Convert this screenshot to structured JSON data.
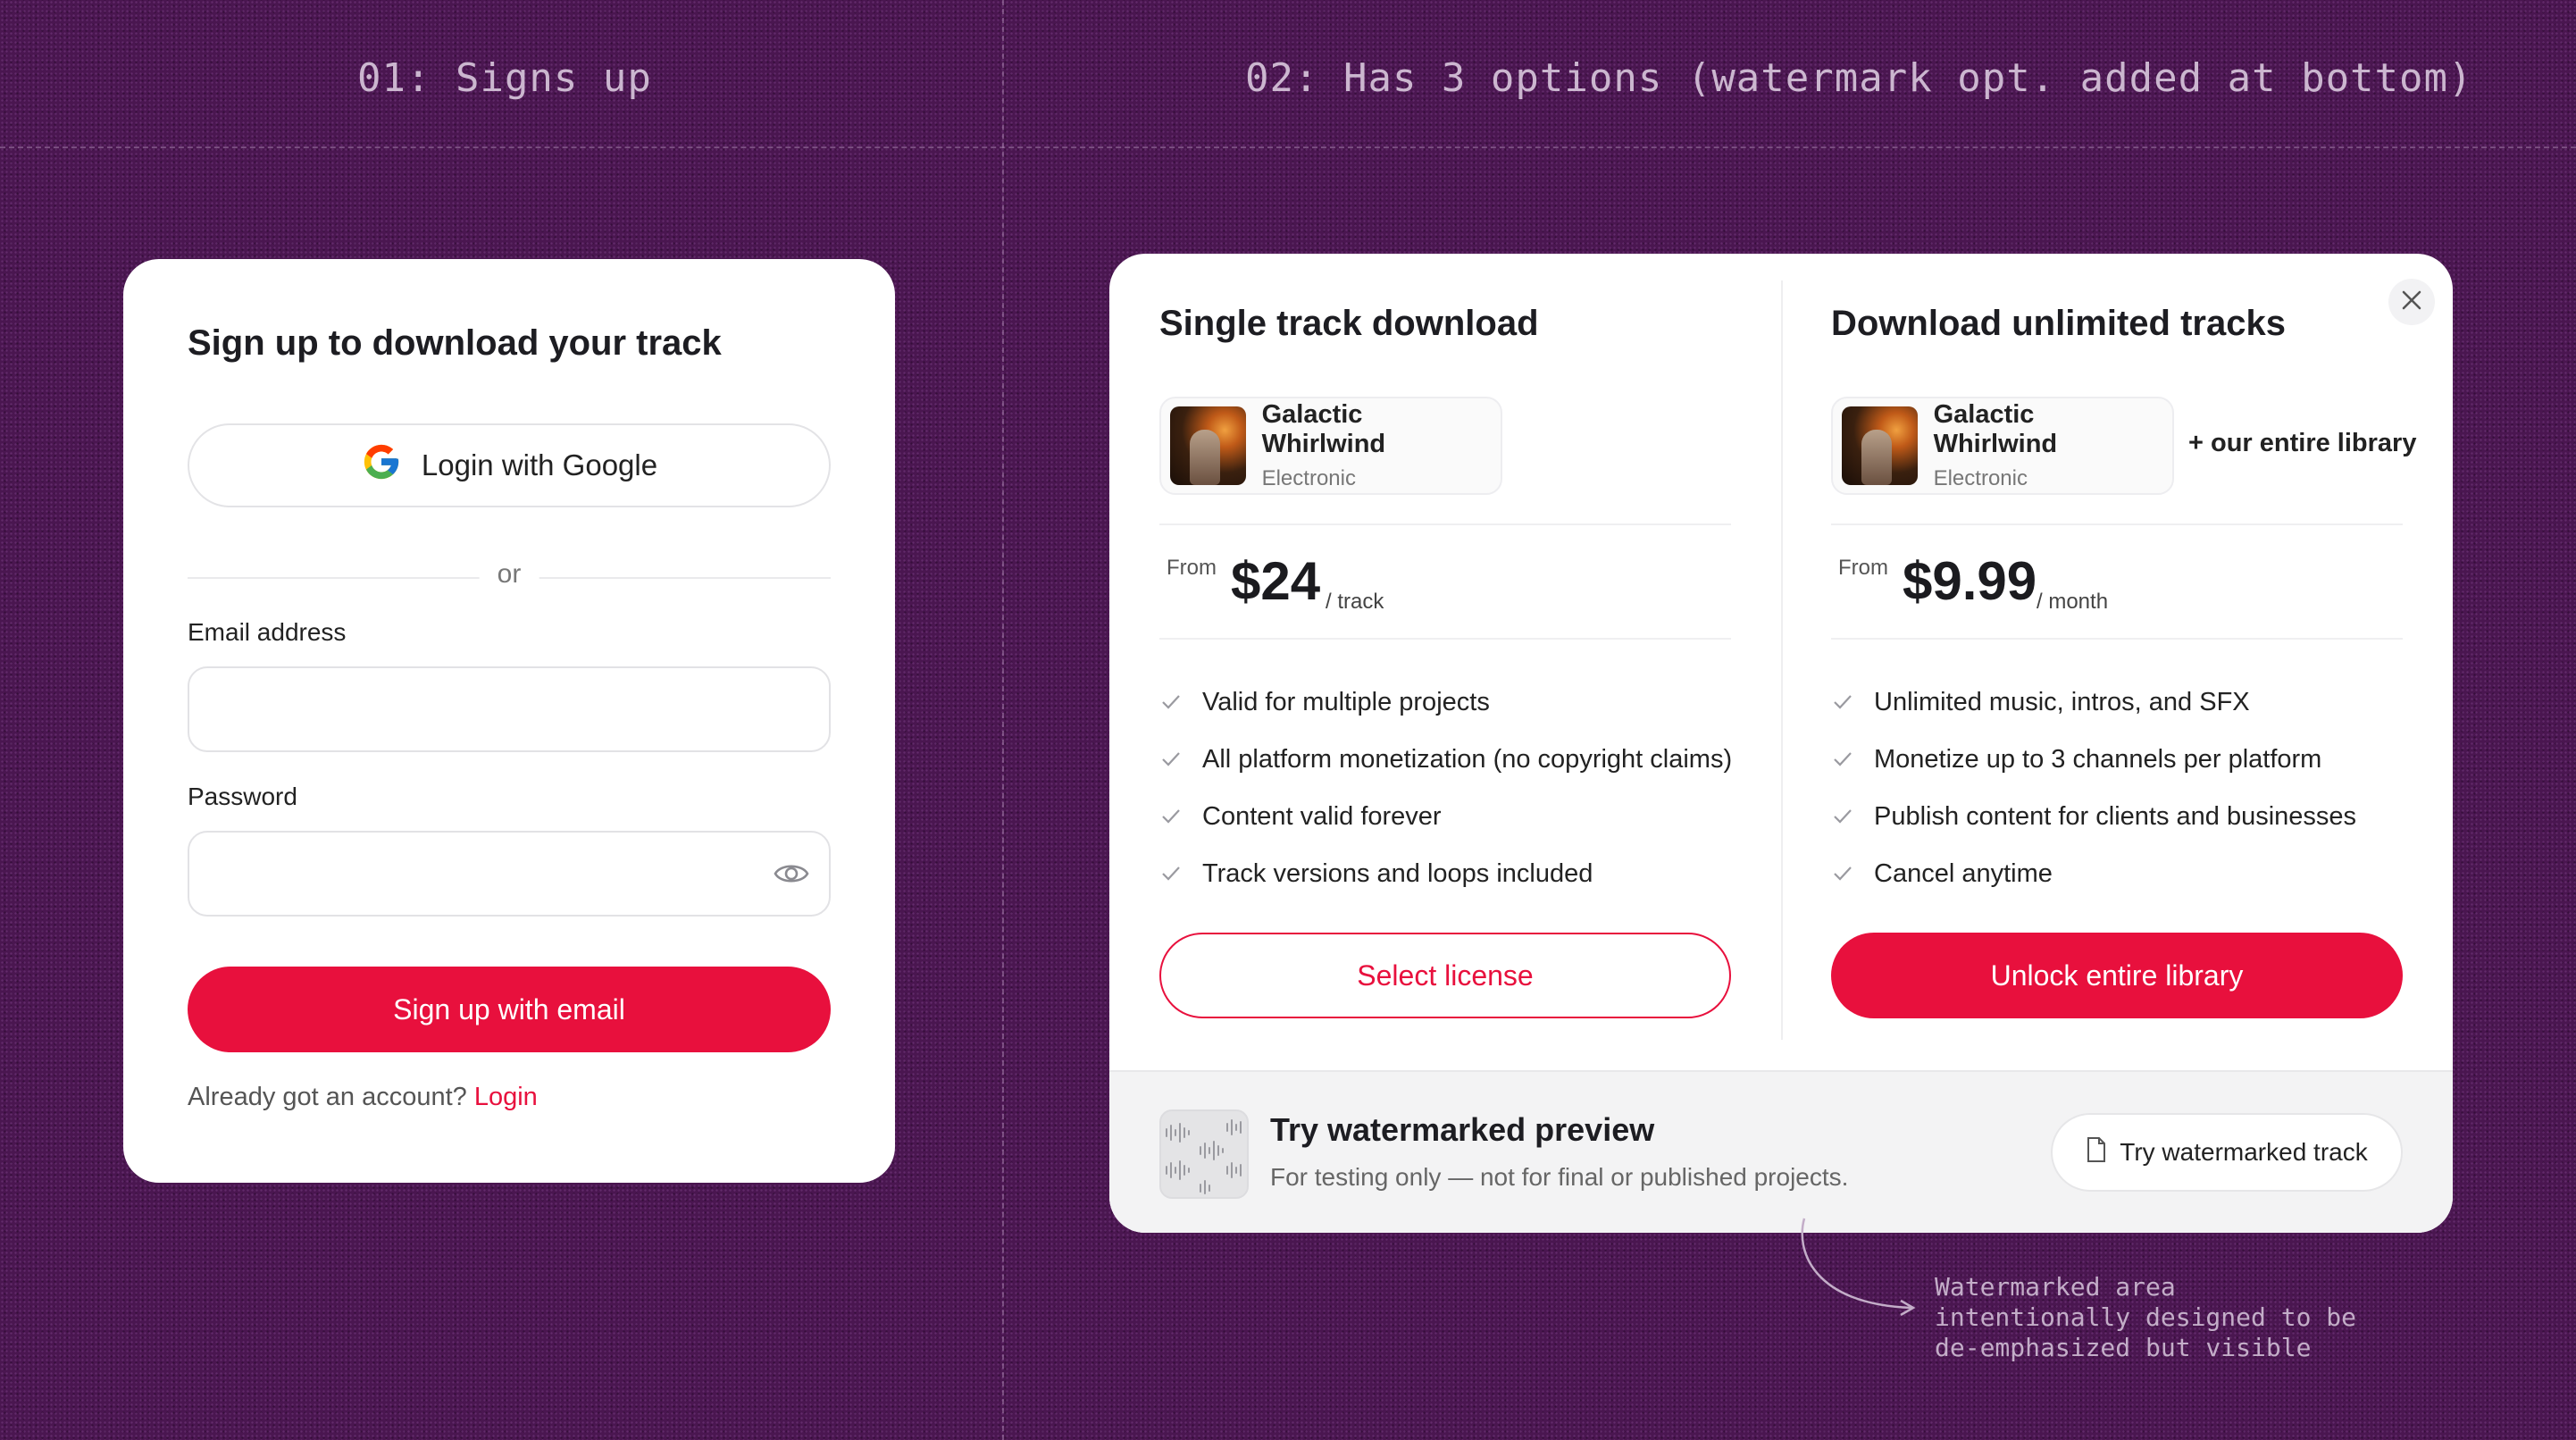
{
  "steps": {
    "step1_title": "01: Signs up",
    "step2_title": "02: Has 3 options (watermark opt. added at bottom)"
  },
  "signup": {
    "title": "Sign up to download your track",
    "google_label": "Login with Google",
    "divider_text": "or",
    "email_label": "Email address",
    "email_value": "",
    "password_label": "Password",
    "password_value": "",
    "submit_label": "Sign up with email",
    "already_text": "Already got an account?",
    "login_link": "Login"
  },
  "pricing": {
    "single": {
      "title": "Single track download",
      "track_name": "Galactic Whirlwind",
      "track_genre": "Electronic",
      "from_label": "From",
      "price": "$24",
      "period": "/ track",
      "features": [
        "Valid for multiple projects",
        "All platform monetization (no copyright claims)",
        "Content valid forever",
        "Track versions and loops included"
      ],
      "button_label": "Select license"
    },
    "unlimited": {
      "title": "Download unlimited tracks",
      "track_name": "Galactic Whirlwind",
      "track_genre": "Electronic",
      "extra_label": "+ our entire library",
      "from_label": "From",
      "price": "$9.99",
      "period": "/ month",
      "features": [
        "Unlimited music, intros, and SFX",
        "Monetize up to 3 channels per platform",
        "Publish content for clients and businesses",
        "Cancel anytime"
      ],
      "button_label": "Unlock entire library"
    },
    "watermark": {
      "title": "Try watermarked preview",
      "subtitle": "For testing only — not for final or published projects.",
      "button_label": "Try watermarked track"
    }
  },
  "annotation": {
    "line1": "Watermarked area",
    "line2": "intentionally designed to be",
    "line3": "de-emphasized but visible"
  },
  "colors": {
    "accent": "#e8103d",
    "background": "#4a1650",
    "card": "#ffffff"
  },
  "icons": [
    "google-icon",
    "eye-icon",
    "check-icon",
    "close-icon",
    "waveform-icon",
    "document-icon",
    "arrow-icon"
  ]
}
